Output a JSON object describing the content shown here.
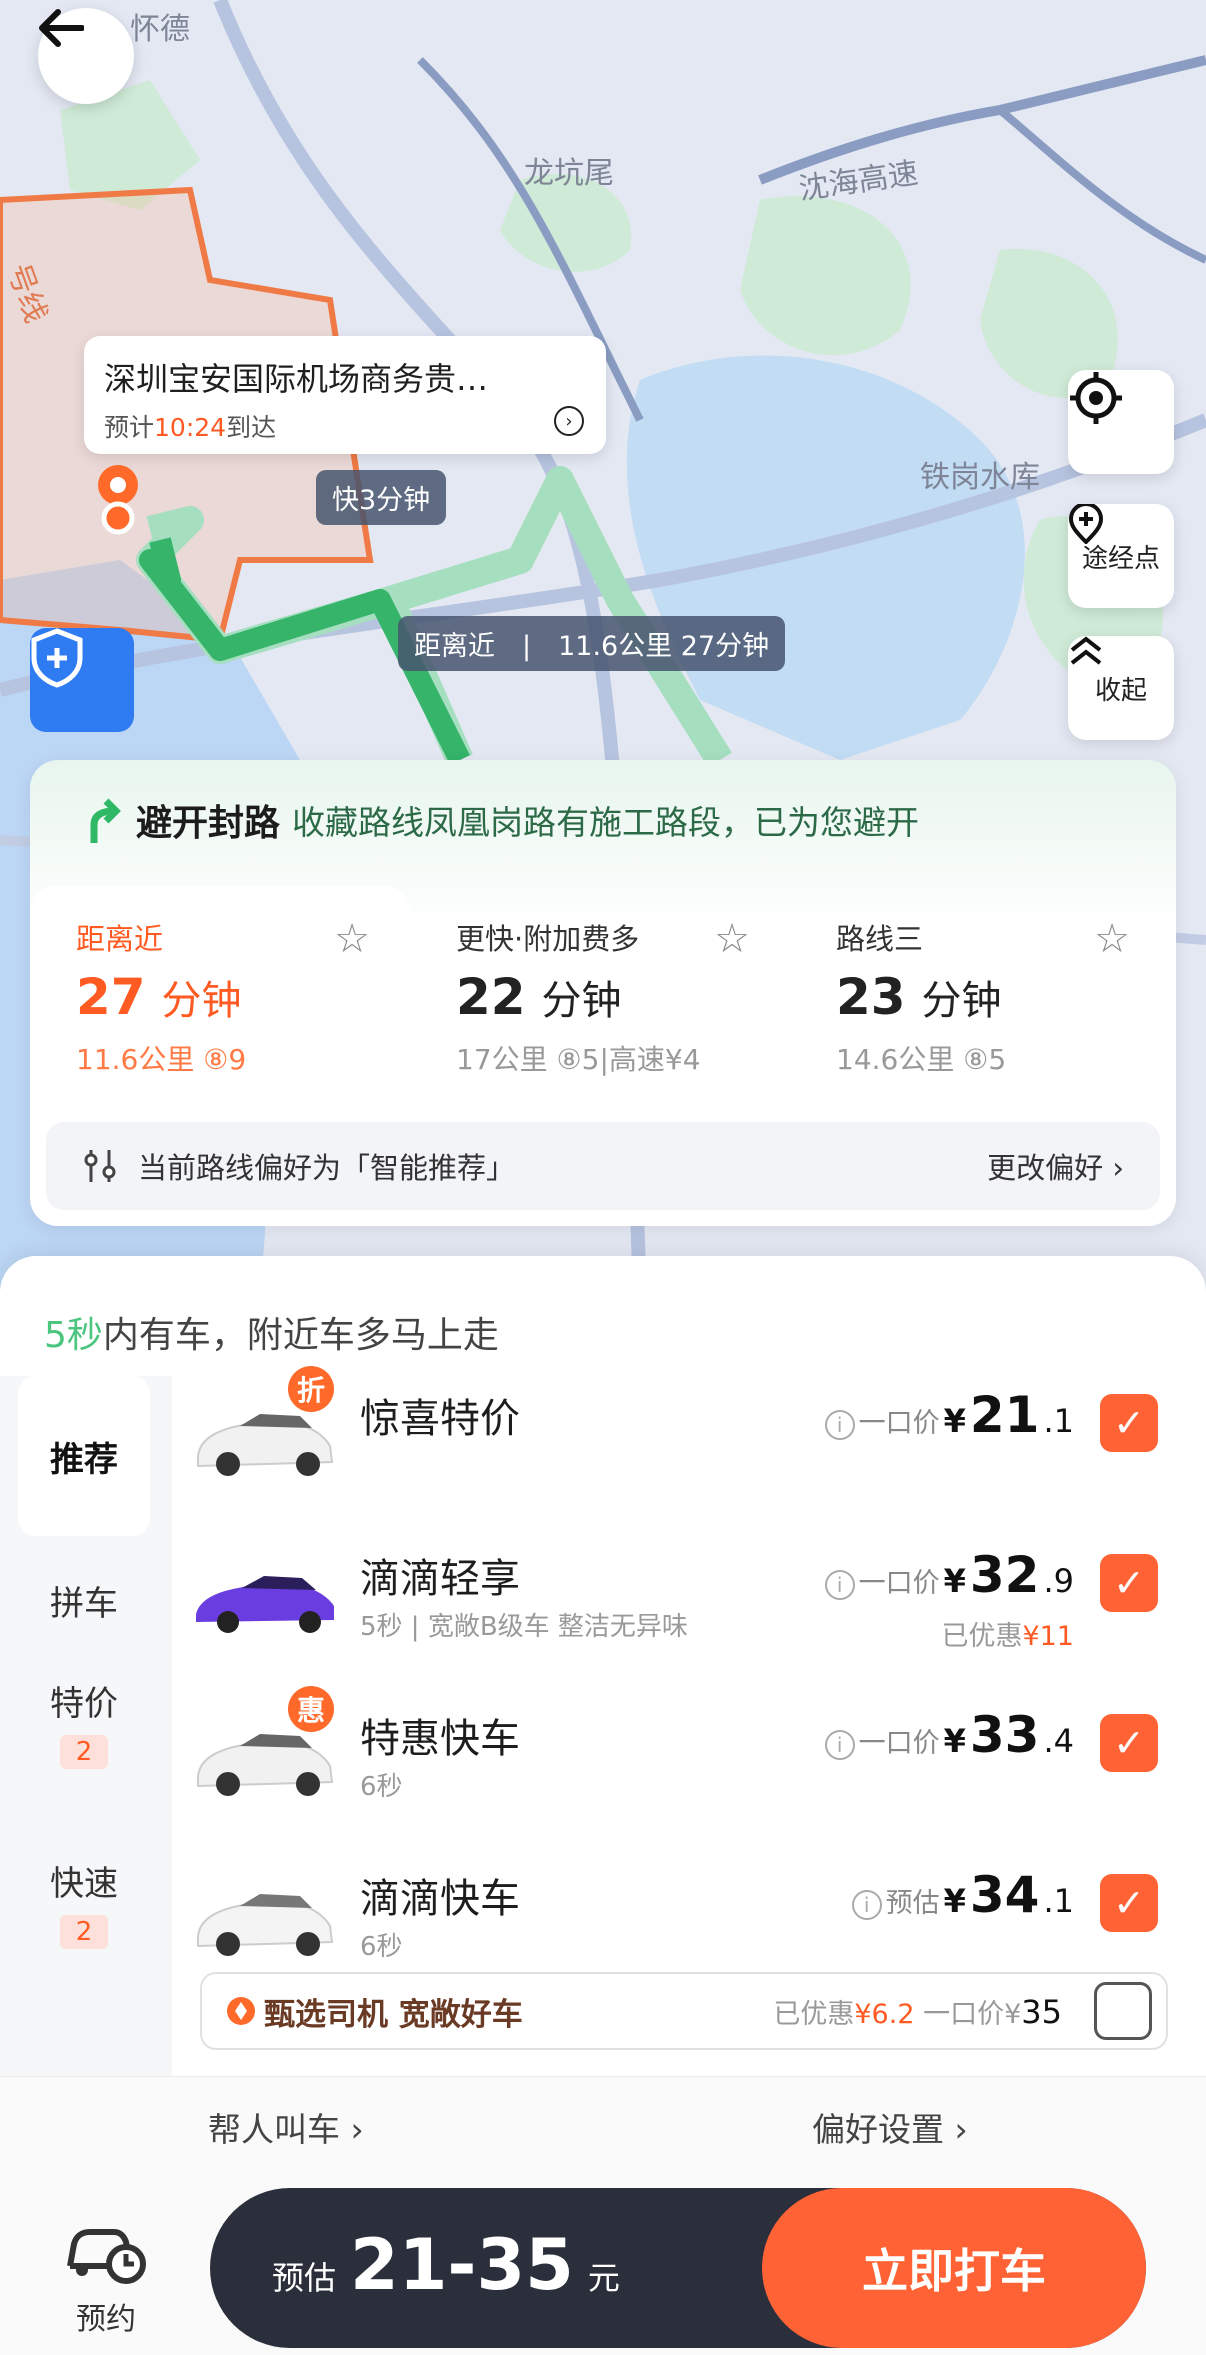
{
  "map": {
    "labels": {
      "a": "怀德",
      "b": "龙坑尾",
      "c": "沈海高速",
      "d": "铁岗水库",
      "e": "号线"
    },
    "destination": {
      "name": "深圳宝安国际机场商务贵…",
      "eta_prefix": "预计",
      "eta_time": "10:24",
      "eta_suffix": "到达"
    },
    "tag_fast": "快3分钟",
    "tag_route": "距离近",
    "tag_route_detail": "11.6公里 27分钟",
    "locate_icon": "locate-icon",
    "waypoint_label": "途经点",
    "collapse_label": "收起"
  },
  "notice": {
    "title": "避开封路",
    "text": "收藏路线凤凰岗路有施工路段，已为您避开"
  },
  "routes": [
    {
      "name": "距离近",
      "time": "27",
      "unit": "分钟",
      "sub": "11.6公里 ⑧9",
      "active": true
    },
    {
      "name": "更快·附加费多",
      "time": "22",
      "unit": "分钟",
      "sub": "17公里 ⑧5|高速¥4",
      "active": false
    },
    {
      "name": "路线三",
      "time": "23",
      "unit": "分钟",
      "sub": "14.6公里 ⑧5",
      "active": false
    }
  ],
  "pref": {
    "text": "当前路线偏好为「智能推荐」",
    "change": "更改偏好 ›"
  },
  "sheet": {
    "head_green": "5秒",
    "head_text": "内有车，附近车多马上走",
    "categories": [
      {
        "label": "推荐"
      },
      {
        "label": "拼车"
      },
      {
        "label": "特价",
        "badge": "2"
      },
      {
        "label": "快速",
        "badge": "2"
      }
    ],
    "cars": [
      {
        "name": "惊喜特价",
        "sub": "",
        "price_label": "一口价",
        "yen": "¥",
        "int": "21",
        "dec": ".1",
        "saved": "",
        "saved_amt": "",
        "badge": "折"
      },
      {
        "name": "滴滴轻享",
        "sub": "5秒 | 宽敞B级车 整洁无异味",
        "price_label": "一口价",
        "yen": "¥",
        "int": "32",
        "dec": ".9",
        "saved": "已优惠",
        "saved_amt": "¥11",
        "badge": ""
      },
      {
        "name": "特惠快车",
        "sub": "6秒",
        "price_label": "一口价",
        "yen": "¥",
        "int": "33",
        "dec": ".4",
        "saved": "",
        "saved_amt": "",
        "badge": "惠"
      },
      {
        "name": "滴滴快车",
        "sub": "6秒",
        "price_label": "预估",
        "yen": "¥",
        "int": "34",
        "dec": ".1",
        "saved": "",
        "saved_amt": "",
        "badge": ""
      }
    ],
    "promo": {
      "title": "甄选司机 宽敞好车",
      "saved": "已优惠",
      "saved_amt": "¥6.2",
      "price_label": "一口价",
      "yen": "¥",
      "price": "35"
    }
  },
  "footer": {
    "help_call": "帮人叫车 ›",
    "pref_settings": "偏好设置 ›",
    "reserve": "预约",
    "est_label": "预估",
    "est_range": "21-35",
    "est_unit": "元",
    "call": "立即打车"
  },
  "colors": {
    "accent": "#ff6335",
    "green": "#2fb866",
    "dark": "#2b2f3c"
  }
}
